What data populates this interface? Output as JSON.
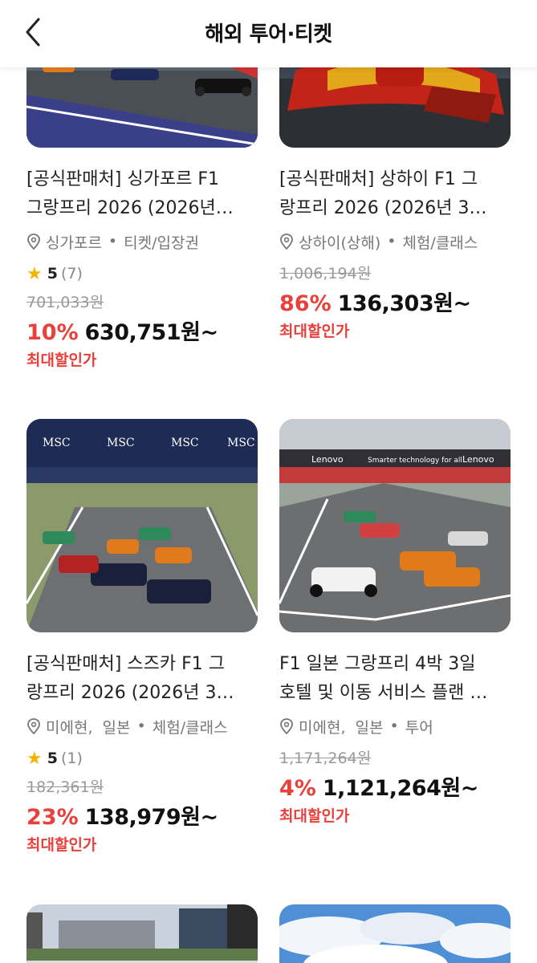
{
  "header": {
    "title": "해외 투어·티켓"
  },
  "cards": [
    {
      "title_line1": "[공식판매처] 싱가포르 F1",
      "title_line2": "그랑프리 2026 (2026년…",
      "location": "싱가포르",
      "category": "티켓/입장권",
      "rating": "5",
      "rating_count": "(7)",
      "original_price": "701,033원",
      "discount": "10%",
      "price": "630,751원~",
      "max_discount_label": "최대할인가"
    },
    {
      "title_line1": "[공식판매처] 상하이 F1 그",
      "title_line2": "랑프리 2026 (2026년 3…",
      "location": "상하이(상해)",
      "category": "체험/클래스",
      "original_price": "1,006,194원",
      "discount": "86%",
      "price": "136,303원~",
      "max_discount_label": "최대할인가"
    },
    {
      "title_line1": "[공식판매처] 스즈카 F1 그",
      "title_line2": "랑프리 2026 (2026년 3…",
      "location": "미에현,  일본",
      "category": "체험/클래스",
      "rating": "5",
      "rating_count": "(1)",
      "original_price": "182,361원",
      "discount": "23%",
      "price": "138,979원~",
      "max_discount_label": "최대할인가"
    },
    {
      "title_line1": "F1 일본 그랑프리 4박 3일",
      "title_line2": "호텔 및 이동 서비스 플랜 …",
      "location": "미에현,  일본",
      "category": "투어",
      "original_price": "1,171,264원",
      "discount": "4%",
      "price": "1,121,264원~",
      "max_discount_label": "최대할인가"
    }
  ],
  "banners": {
    "msc": "MSC",
    "lenovo": "Lenovo",
    "lenovo_tagline": "Smarter technology for all"
  },
  "icons": {
    "back": "chevron-left-icon",
    "location": "location-pin-icon",
    "star": "star-icon"
  },
  "colors": {
    "accent_red": "#e8413b",
    "star": "#f5b400",
    "muted": "#777777"
  }
}
